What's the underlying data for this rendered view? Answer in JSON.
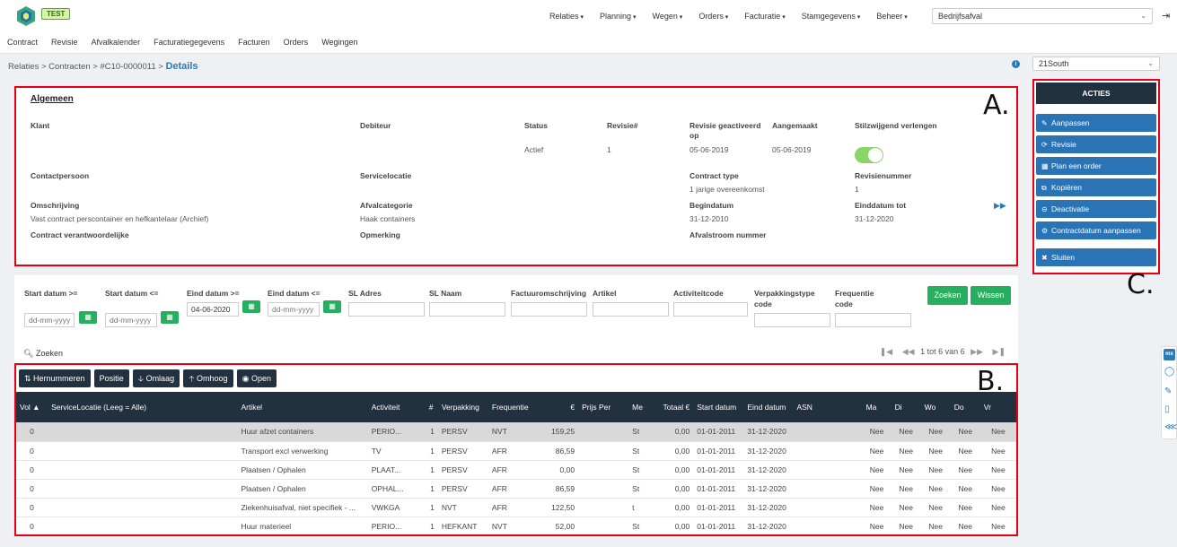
{
  "app": {
    "env_badge": "TEST"
  },
  "mainnav": [
    "Relaties",
    "Planning",
    "Wegen",
    "Orders",
    "Facturatie",
    "Stamgegevens",
    "Beheer"
  ],
  "company_select": {
    "value": "Bedrijfsafval"
  },
  "subnav": [
    "Contract",
    "Revisie",
    "Afvalkalender",
    "Facturatiegegevens",
    "Facturen",
    "Orders",
    "Wegingen"
  ],
  "breadcrumb": {
    "path": "Relaties > Contracten > #C10-0000011 >",
    "current": "Details"
  },
  "region_select": {
    "value": "21South"
  },
  "annotations": {
    "a": "A.",
    "b": "B.",
    "c": "C."
  },
  "algemeen": {
    "title": "Algemeen",
    "labels": {
      "klant": "Klant",
      "debiteur": "Debiteur",
      "status": "Status",
      "revisie_nr": "Revisie#",
      "revisie_geactiveerd": "Revisie geactiveerd op",
      "aangemaakt": "Aangemaakt",
      "stilzwijgend": "Stilzwijgend verlengen",
      "contactpersoon": "Contactpersoon",
      "servicelocatie": "Servicelocatie",
      "contract_type": "Contract type",
      "revisienummer": "Revisienummer",
      "omschrijving": "Omschrijving",
      "afvalcategorie": "Afvalcategorie",
      "begindatum": "Begindatum",
      "einddatum_tot": "Einddatum tot",
      "contract_verantwoordelijke": "Contract verantwoordelijke",
      "opmerking": "Opmerking",
      "afvalstroom_nummer": "Afvalstroom nummer"
    },
    "values": {
      "status": "Actief",
      "revisie_nr": "1",
      "revisie_geactiveerd": "05-06-2019",
      "aangemaakt": "05-06-2019",
      "stilzwijgend_on": true,
      "contract_type": "1 jarige overeenkomst",
      "revisienummer": "1",
      "omschrijving": "Vast contract perscontainer en hefkantelaar (Archief)",
      "afvalcategorie": "Haak containers",
      "begindatum": "31-12-2010",
      "einddatum_tot": "31-12-2020"
    }
  },
  "filters": {
    "start_ge": "Start datum >=",
    "start_le": "Start datum <=",
    "eind_ge": "Eind datum >=",
    "eind_le": "Eind datum <=",
    "sl_adres": "SL Adres",
    "sl_naam": "SL Naam",
    "factuur": "Factuuromschrijving",
    "artikel": "Artikel",
    "activiteit": "Activiteitcode",
    "verpakking": "Verpakkingstype code",
    "frequentie": "Frequentie code",
    "date_placeholder": "dd-mm-yyyy",
    "eind_ge_value": "04-06-2020",
    "zoeken_btn": "Zoeken",
    "wissen_btn": "Wissen",
    "zoeken_link": "Zoeken",
    "pager_text": "1 tot 6 van 6"
  },
  "toolbar": [
    "Hernummeren",
    "Positie",
    "Omlaag",
    "Omhoog",
    "Open"
  ],
  "grid": {
    "headers": [
      "Vol ▲",
      "ServiceLocatie (Leeg = Alle)",
      "Artikel",
      "Activiteit",
      "#",
      "Verpakking",
      "Frequentie",
      "€",
      "Prijs Per",
      "Me",
      "Totaal €",
      "Start datum",
      "Eind datum",
      "ASN",
      "Ma",
      "Di",
      "Wo",
      "Do",
      "Vr"
    ],
    "rows": [
      [
        "0",
        "",
        "Huur afzet containers",
        "PERIO...",
        "1",
        "PERSV",
        "NVT",
        "159,25",
        "",
        "St",
        "0,00",
        "01-01-2011",
        "31-12-2020",
        "",
        "Nee",
        "Nee",
        "Nee",
        "Nee",
        "Nee"
      ],
      [
        "0",
        "",
        "Transport excl verwerking",
        "TV",
        "1",
        "PERSV",
        "AFR",
        "86,59",
        "",
        "St",
        "0,00",
        "01-01-2011",
        "31-12-2020",
        "",
        "Nee",
        "Nee",
        "Nee",
        "Nee",
        "Nee"
      ],
      [
        "0",
        "",
        "Plaatsen / Ophalen",
        "PLAAT...",
        "1",
        "PERSV",
        "AFR",
        "0,00",
        "",
        "St",
        "0,00",
        "01-01-2011",
        "31-12-2020",
        "",
        "Nee",
        "Nee",
        "Nee",
        "Nee",
        "Nee"
      ],
      [
        "0",
        "",
        "Plaatsen / Ophalen",
        "OPHAL...",
        "1",
        "PERSV",
        "AFR",
        "86,59",
        "",
        "St",
        "0,00",
        "01-01-2011",
        "31-12-2020",
        "",
        "Nee",
        "Nee",
        "Nee",
        "Nee",
        "Nee"
      ],
      [
        "0",
        "",
        "Ziekenhuisafval, niet specifiek - ...",
        "VWKGA",
        "1",
        "NVT",
        "AFR",
        "122,50",
        "",
        "t",
        "0,00",
        "01-01-2011",
        "31-12-2020",
        "",
        "Nee",
        "Nee",
        "Nee",
        "Nee",
        "Nee"
      ],
      [
        "0",
        "",
        "Huur materieel",
        "PERIO...",
        "1",
        "HEFKANT",
        "NVT",
        "52,00",
        "",
        "St",
        "0,00",
        "01-01-2011",
        "31-12-2020",
        "",
        "Nee",
        "Nee",
        "Nee",
        "Nee",
        "Nee"
      ]
    ]
  },
  "acties": {
    "title": "ACTIES",
    "buttons": [
      "Aanpassen",
      "Revisie",
      "Plan een order",
      "Kopiëren",
      "Deactivatie",
      "Contractdatum aanpassen",
      "Sluiten"
    ]
  },
  "side_tools": {
    "mx": "mx"
  },
  "colors": {
    "accent_blue": "#2a73b5",
    "dark_header": "#22313f",
    "green": "#27ae60",
    "annotation_red": "#e60012"
  }
}
